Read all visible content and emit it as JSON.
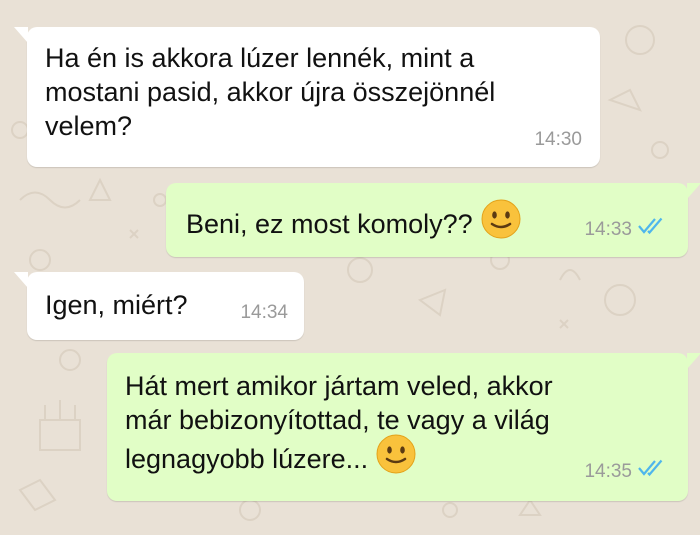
{
  "chat": {
    "messages": [
      {
        "direction": "incoming",
        "lines": [
          "Ha én is akkora lúzer lennék, mint a",
          "mostani pasid, akkor újra összejönnél",
          "velem?"
        ],
        "time": "14:30"
      },
      {
        "direction": "outgoing",
        "text": "Beni, ez most komoly??",
        "emoji": "slightly-smiling-face-icon",
        "time": "14:33",
        "status": "read"
      },
      {
        "direction": "incoming",
        "text": "Igen, miért?",
        "time": "14:34"
      },
      {
        "direction": "outgoing",
        "lines": [
          "Hát mert amikor jártam veled, akkor",
          "már bebizonyítottad, te vagy a világ",
          "legnagyobb lúzere..."
        ],
        "emoji": "slightly-smiling-face-icon",
        "time": "14:35",
        "status": "read"
      }
    ]
  },
  "colors": {
    "wallpaper": "#e9e1d6",
    "incoming_bubble": "#ffffff",
    "outgoing_bubble": "#e1fec6",
    "timestamp": "#9a9a9a",
    "read_ticks": "#4fb6ec"
  }
}
